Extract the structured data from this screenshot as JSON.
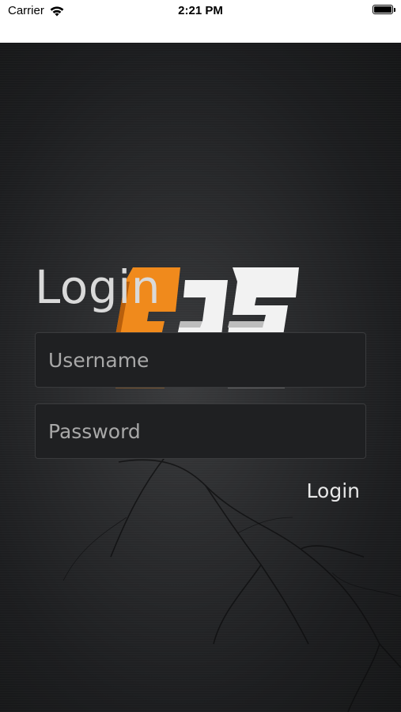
{
  "status_bar": {
    "carrier": "Carrier",
    "time": "2:21 PM"
  },
  "login": {
    "title": "Login",
    "username_placeholder": "Username",
    "password_placeholder": "Password",
    "button_label": "Login"
  },
  "colors": {
    "background": "#1c1d1f",
    "field": "#1f2022",
    "logo_orange": "#f08a1c",
    "logo_white": "#f2f2f2"
  }
}
